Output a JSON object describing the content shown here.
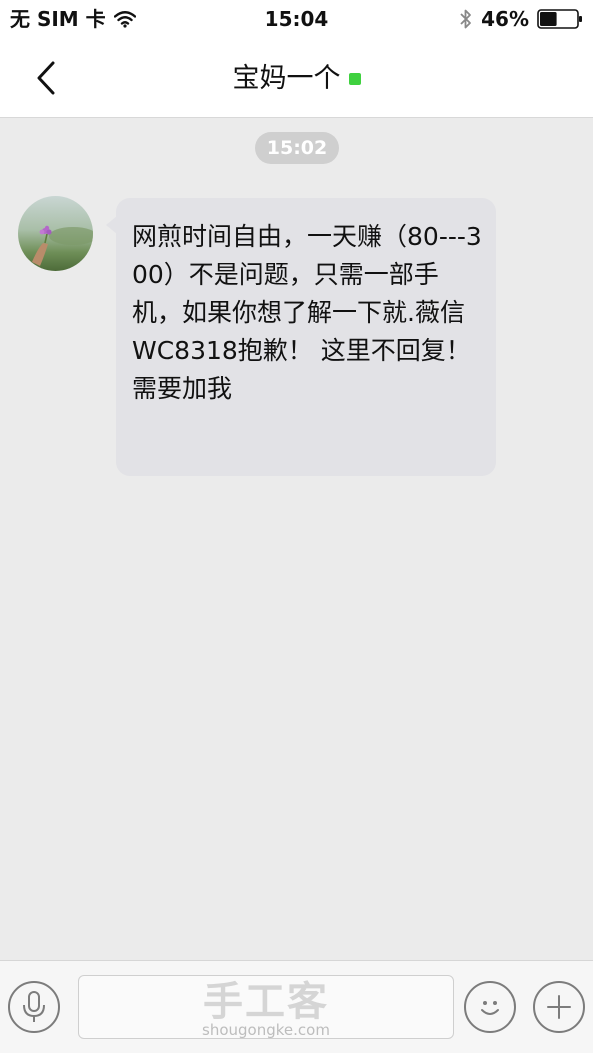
{
  "status_bar": {
    "carrier": "无 SIM 卡",
    "time": "15:04",
    "battery_percent": "46%",
    "battery_level": 0.46,
    "icons": [
      "wifi-icon",
      "bluetooth-icon",
      "battery-icon"
    ]
  },
  "nav": {
    "back_icon": "chevron-left-icon",
    "title": "宝妈一个",
    "online_indicator_color": "#3fd13f"
  },
  "chat": {
    "timestamp": "15:02",
    "messages": [
      {
        "sender": "incoming",
        "avatar": "avatar-photo",
        "text": "网煎时间自由，一天赚（80---300）不是问题，只需一部手机，如果你想了解一下就.薇信WC8318抱歉！ 这里不回复！需要加我"
      }
    ]
  },
  "input_bar": {
    "voice_icon": "microphone-icon",
    "emoji_icon": "smiley-icon",
    "plus_icon": "plus-icon",
    "watermark_main": "手工客",
    "watermark_sub": "shougongke.com"
  },
  "colors": {
    "chat_background": "#ebebeb",
    "bubble": "#e2e2e6",
    "timestamp_pill": "#cfcfcf",
    "online": "#3fd13f"
  }
}
